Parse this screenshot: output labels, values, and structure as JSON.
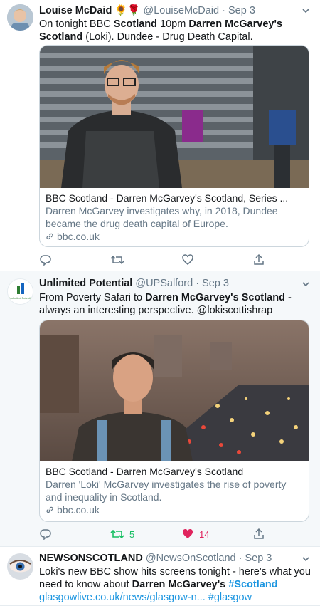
{
  "tweets": [
    {
      "name": "Louise McDaid",
      "emoji": "🌻🌹",
      "handle": "@LouiseMcDaid",
      "date": "· Sep 3",
      "text": {
        "p1": "On tonight BBC ",
        "b1": "Scotland",
        "p2": " 10pm ",
        "b2": "Darren McGarvey's Scotland",
        "p3": " (Loki).  Dundee - Drug Death Capital."
      },
      "card": {
        "title": "BBC Scotland - Darren McGarvey's Scotland, Series ...",
        "description": "Darren McGarvey investigates why, in 2018, Dundee became the drug death capital of Europe.",
        "domain": "bbc.co.uk"
      },
      "actions": {
        "retweets": "",
        "likes": ""
      }
    },
    {
      "name": "Unlimited Potential",
      "handle": "@UPSalford",
      "date": "· Sep 3",
      "avatar_text": "Unlimited Potential",
      "text": {
        "p1": "From Poverty Safari to ",
        "b1": "Darren McGarvey's Scotland",
        "p2": " - always an interesting perspective. @lokiscottishrap"
      },
      "card": {
        "title": "BBC Scotland - Darren McGarvey's Scotland",
        "description": "Darren 'Loki' McGarvey investigates the rise of poverty and inequality in Scotland.",
        "domain": "bbc.co.uk"
      },
      "actions": {
        "retweets": "5",
        "likes": "14"
      }
    },
    {
      "name": "NEWSONSCOTLAND",
      "handle": "@NewsOnScotland",
      "date": "· Sep 3",
      "text": {
        "p1": "Loki's new BBC show hits screens tonight - here's what you need to know about ",
        "b1": "Darren McGarvey's",
        "tag": "#Scotland",
        "url": "glasgowlive.co.uk/news/glasgow-n...",
        "tag2": "#glasgow"
      }
    }
  ],
  "colors": {
    "link": "#1b95e0",
    "retweet_active": "#17bf63",
    "like_active": "#e0245e",
    "muted": "#657786"
  }
}
